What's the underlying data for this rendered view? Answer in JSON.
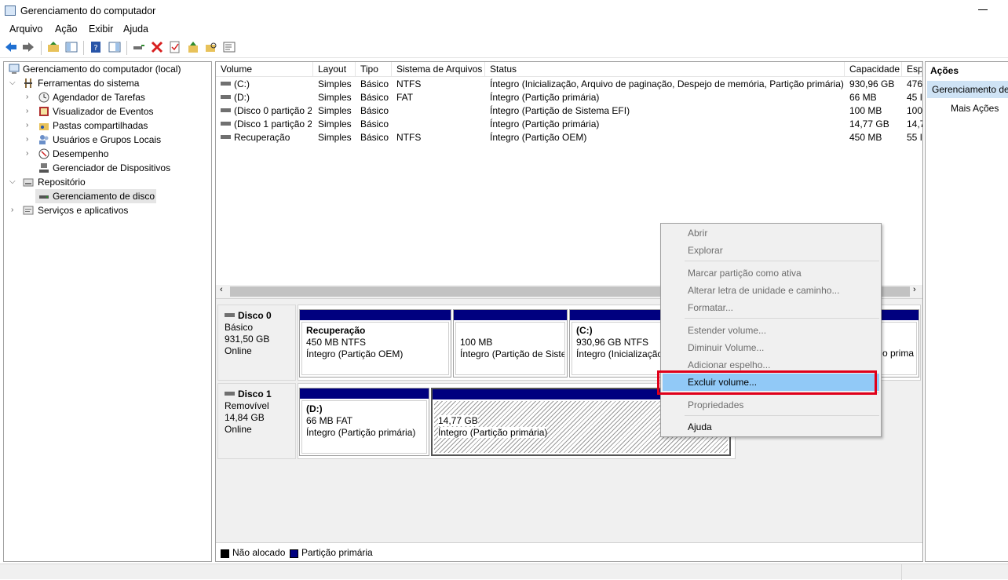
{
  "window": {
    "title": "Gerenciamento do computador"
  },
  "menu": [
    "Arquivo",
    "Ação",
    "Exibir",
    "Ajuda"
  ],
  "tree": {
    "root": "Gerenciamento do computador (local)",
    "system_tools": "Ferramentas do sistema",
    "task_scheduler": "Agendador de Tarefas",
    "event_viewer": "Visualizador de Eventos",
    "shared_folders": "Pastas compartilhadas",
    "users_groups": "Usuários e Grupos Locais",
    "performance": "Desempenho",
    "device_manager": "Gerenciador de Dispositivos",
    "storage": "Repositório",
    "disk_management": "Gerenciamento de disco",
    "services": "Serviços e aplicativos"
  },
  "volumes": {
    "headers": [
      "Volume",
      "Layout",
      "Tipo",
      "Sistema de Arquivos",
      "Status",
      "Capacidade",
      "Esp"
    ],
    "rows": [
      {
        "volume": "(C:)",
        "layout": "Simples",
        "type": "Básico",
        "fs": "NTFS",
        "status": "Íntegro (Inicialização, Arquivo de paginação, Despejo de memória, Partição primária)",
        "capacity": "930,96 GB",
        "free": "476"
      },
      {
        "volume": "(D:)",
        "layout": "Simples",
        "type": "Básico",
        "fs": "FAT",
        "status": "Íntegro (Partição primária)",
        "capacity": "66 MB",
        "free": "45 I"
      },
      {
        "volume": "(Disco 0 partição 2)",
        "layout": "Simples",
        "type": "Básico",
        "fs": "",
        "status": "Íntegro (Partição de Sistema EFI)",
        "capacity": "100 MB",
        "free": "100"
      },
      {
        "volume": "(Disco 1 partição 2)",
        "layout": "Simples",
        "type": "Básico",
        "fs": "",
        "status": "Íntegro (Partição primária)",
        "capacity": "14,77 GB",
        "free": "14,7"
      },
      {
        "volume": "Recuperação",
        "layout": "Simples",
        "type": "Básico",
        "fs": "NTFS",
        "status": "Íntegro (Partição OEM)",
        "capacity": "450 MB",
        "free": "55 I"
      }
    ]
  },
  "disk0": {
    "name": "Disco 0",
    "kind": "Básico",
    "size": "931,50 GB",
    "state": "Online",
    "partitions": [
      {
        "title": "Recuperação",
        "line1": "450 MB NTFS",
        "line2": "Íntegro (Partição OEM)"
      },
      {
        "title": "",
        "line1": "100 MB",
        "line2": "Íntegro (Partição de Sister"
      },
      {
        "title": "(C:)",
        "line1": "930,96 GB NTFS",
        "line2": "Íntegro (Inicialização"
      },
      {
        "tail": "o prima"
      }
    ]
  },
  "disk1": {
    "name": "Disco 1",
    "kind": "Removível",
    "size": "14,84 GB",
    "state": "Online",
    "partitions": [
      {
        "title": "(D:)",
        "line1": "66 MB FAT",
        "line2": "Íntegro (Partição primária)"
      },
      {
        "title": "",
        "line1": "14,77 GB",
        "line2": "Íntegro (Partição primária)"
      }
    ]
  },
  "legend": {
    "unallocated": "Não alocado",
    "primary": "Partição primária"
  },
  "actions": {
    "title": "Ações",
    "selected": "Gerenciamento de",
    "more": "Mais Ações"
  },
  "context_menu": {
    "open": "Abrir",
    "explore": "Explorar",
    "mark_active": "Marcar partição como ativa",
    "change_letter": "Alterar letra de unidade e caminho...",
    "format": "Formatar...",
    "extend": "Estender volume...",
    "shrink": "Diminuir Volume...",
    "mirror": "Adicionar espelho...",
    "delete": "Excluir volume...",
    "properties": "Propriedades",
    "help": "Ajuda"
  },
  "colors": {
    "primary_partition": "#00007f",
    "highlight": "#91c9f7",
    "annotation": "#e0001a"
  }
}
